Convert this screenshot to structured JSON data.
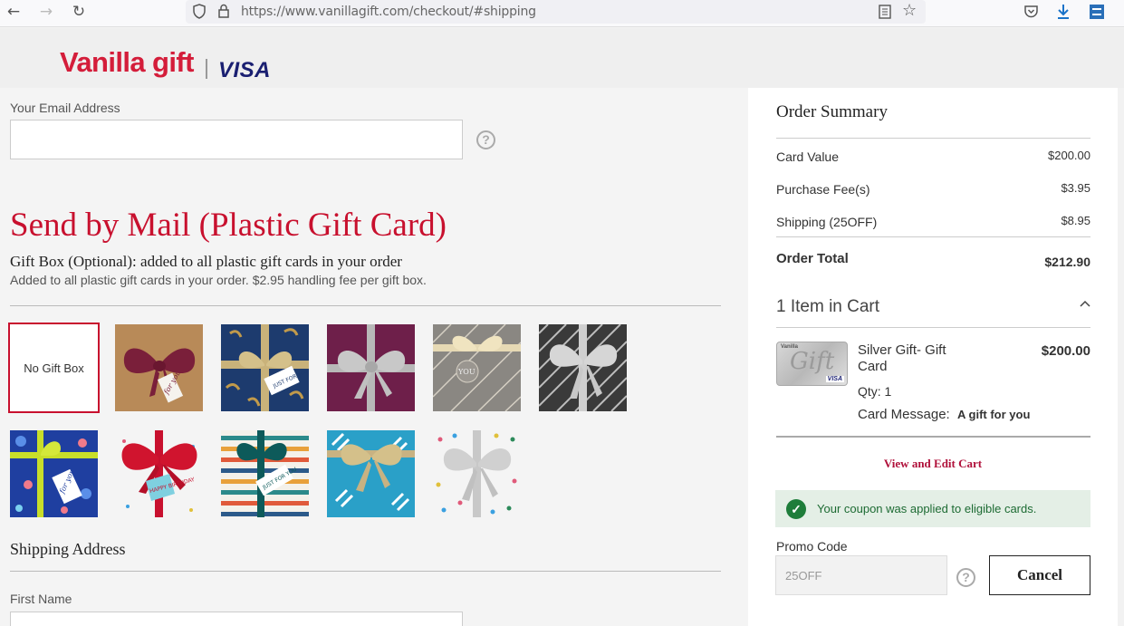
{
  "browser": {
    "url": "https://www.vanillagift.com/checkout/#shipping"
  },
  "header": {
    "brand": "Vanilla gift",
    "partner": "VISA"
  },
  "form": {
    "email_label": "Your Email Address",
    "help_glyph": "?",
    "section_title": "Send by Mail (Plastic Gift Card)",
    "giftbox_heading_bold": "Gift Box",
    "giftbox_heading_rest": " (Optional): added to all plastic gift cards in your order",
    "giftbox_sub": "Added to all plastic gift cards in your order. $2.95 handling fee per gift box.",
    "no_gift_box": "No Gift Box",
    "shipping_title": "Shipping Address",
    "first_name_label": "First Name"
  },
  "gift_boxes": [
    {
      "name": "maroon-bow-kraft",
      "tag_text": "for you"
    },
    {
      "name": "gold-bow-navy-leaves",
      "tag_text": "JUST FOR you"
    },
    {
      "name": "silver-bow-burgundy",
      "tag_text": ""
    },
    {
      "name": "champagne-bow-geometric",
      "tag_text": "YOU"
    },
    {
      "name": "silver-bow-greek-key",
      "tag_text": ""
    },
    {
      "name": "lime-ribbon-confetti",
      "tag_text": "for you"
    },
    {
      "name": "red-bow-birthday",
      "tag_text": "HAPPY BIRTHDAY"
    },
    {
      "name": "teal-ribbon-stripes",
      "tag_text": "JUST FOR YOU"
    },
    {
      "name": "gold-bow-turquoise",
      "tag_text": ""
    },
    {
      "name": "silver-bow-polka-dots",
      "tag_text": ""
    }
  ],
  "summary": {
    "title": "Order Summary",
    "rows": [
      {
        "label": "Card Value",
        "value": "$200.00"
      },
      {
        "label": "Purchase Fee(s)",
        "value": "$3.95"
      },
      {
        "label": "Shipping (25OFF)",
        "value": "$8.95"
      }
    ],
    "total_label": "Order Total",
    "total_value": "$212.90",
    "cart_heading": "1 Item in Cart",
    "item": {
      "name_line1": "Silver Gift- Gift",
      "name_line2": "Card",
      "price": "$200.00",
      "qty": "Qty: 1",
      "message_label": "Card Message:",
      "message_value": "A gift for you",
      "card_art_script": "Gift",
      "card_art_brand": "Vanilla",
      "card_art_network": "VISA"
    },
    "view_edit": "View and Edit Cart",
    "coupon_msg": "Your coupon was applied to eligible cards.",
    "promo_label": "Promo Code",
    "promo_value": "25OFF",
    "cancel_label": "Cancel"
  },
  "colors": {
    "brand_red": "#c8102e",
    "visa_blue": "#1a1f71",
    "success_green": "#1e7d3a",
    "link_red": "#b0103a"
  }
}
